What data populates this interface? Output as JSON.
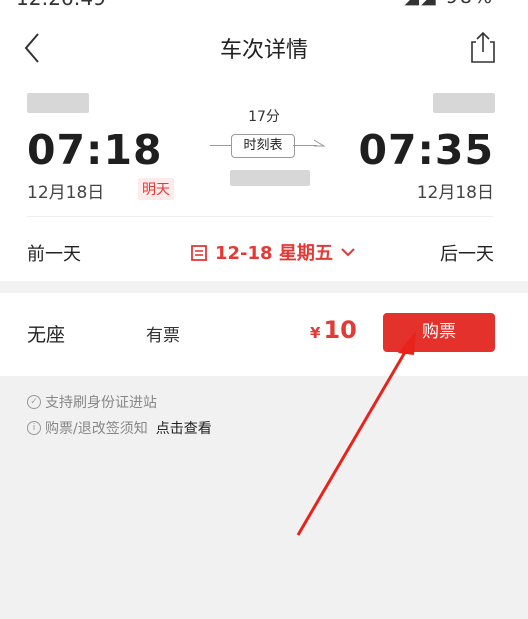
{
  "status_bar": {
    "time": "12:26:49",
    "battery": "98%"
  },
  "nav": {
    "title": "车次详情",
    "back_icon": "chevron-left-icon",
    "share_icon": "share-icon"
  },
  "train": {
    "duration": "17分",
    "schedule_button": "时刻表",
    "departure_time": "07:18",
    "departure_date": "12月18日",
    "tomorrow": "明天",
    "arrival_time": "07:35",
    "arrival_date": "12月18日"
  },
  "day_selector": {
    "prev": "前一天",
    "current": "12-18 星期五",
    "next": "后一天"
  },
  "seat": {
    "type": "无座",
    "status": "有票",
    "currency": "¥",
    "price": "10",
    "buy_button": "购票"
  },
  "info": {
    "id_line": "支持刷身份证进站",
    "notice_line": "购票/退改签须知",
    "notice_link": "点击查看"
  },
  "colors": {
    "accent": "#e53935",
    "panel_bg": "#f1f1f1"
  }
}
